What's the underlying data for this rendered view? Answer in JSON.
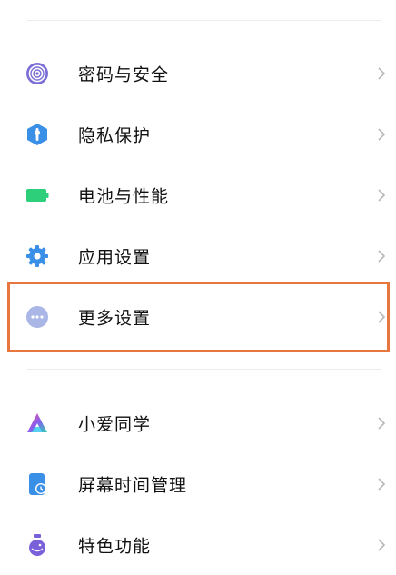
{
  "group1": {
    "items": [
      {
        "label": "密码与安全",
        "icon": "fingerprint-icon"
      },
      {
        "label": "隐私保护",
        "icon": "privacy-shield-icon"
      },
      {
        "label": "电池与性能",
        "icon": "battery-icon"
      },
      {
        "label": "应用设置",
        "icon": "gear-icon"
      },
      {
        "label": "更多设置",
        "icon": "more-dots-icon"
      }
    ]
  },
  "group2": {
    "items": [
      {
        "label": "小爱同学",
        "icon": "xiaoai-assistant-icon"
      },
      {
        "label": "屏幕时间管理",
        "icon": "screen-time-icon"
      },
      {
        "label": "特色功能",
        "icon": "feature-flask-icon"
      }
    ]
  },
  "highlighted_item": "更多设置",
  "colors": {
    "highlight_border": "#e8773f",
    "fingerprint": "#7b6fd6",
    "privacy": "#3a8fe6",
    "battery": "#2ecf7a",
    "gear": "#3a8fe6",
    "more": "#a9b6e6",
    "screen_time": "#3a8fe6",
    "feature": "#7b61d9"
  }
}
